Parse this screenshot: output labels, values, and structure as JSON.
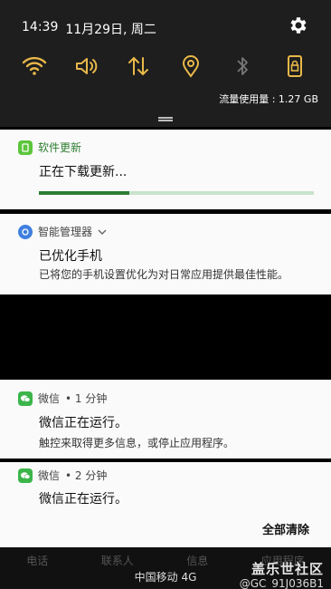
{
  "status": {
    "time": "14:39",
    "date": "11月29日, 周二"
  },
  "quick_panel": {
    "data_usage": "流量使用量 : 1.27 GB",
    "accent_color": "#e8b84a",
    "tiles": [
      "wifi-icon",
      "volume-icon",
      "mobile-data-icon",
      "location-icon",
      "bluetooth-icon",
      "lock-rotation-icon"
    ]
  },
  "notifications": [
    {
      "app": "软件更新",
      "title": "正在下载更新...",
      "progress": 0.33
    },
    {
      "app": "智能管理器",
      "title": "已优化手机",
      "body": "已将您的手机设置优化为对日常应用提供最佳性能。"
    },
    {
      "app": "微信",
      "time": "• 1 分钟",
      "title": "微信正在运行。",
      "body": "触控来取得更多信息，或停止应用程序。"
    },
    {
      "app": "微信",
      "time": "• 2 分钟",
      "title": "微信正在运行。"
    }
  ],
  "clear_all": "全部清除",
  "dock": {
    "items": [
      "电话",
      "联系人",
      "信息",
      "应用程序"
    ]
  },
  "carrier": "中国移动 4G",
  "watermark": {
    "title": "盖乐世社区",
    "user": "@GC_91J036B1"
  }
}
